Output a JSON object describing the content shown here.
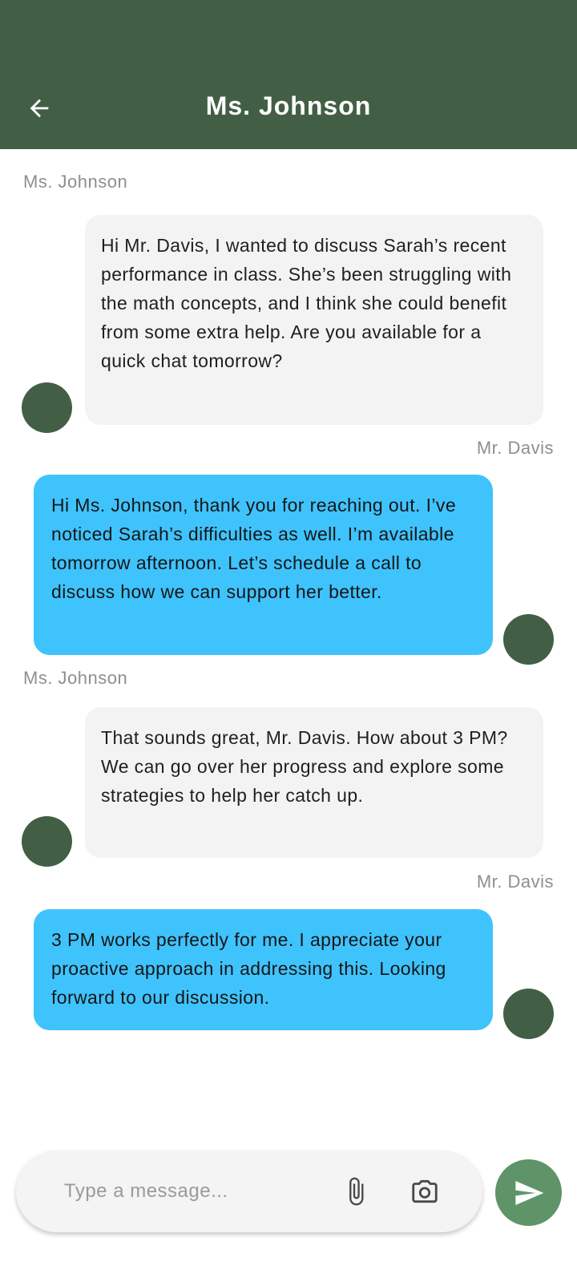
{
  "header": {
    "title": "Ms. Johnson",
    "back_icon": "arrow-back-icon",
    "color": "#425f45"
  },
  "messages": [
    {
      "sender": "Ms. Johnson",
      "side": "incoming",
      "text": "Hi Mr. Davis, I wanted to discuss Sarah’s recent performance in class. She’s been struggling with the math concepts, and I think she could benefit from some extra help. Are you available for a quick chat tomorrow?"
    },
    {
      "sender": "Mr. Davis",
      "side": "outgoing",
      "text": "Hi Ms. Johnson, thank you for reaching out. I’ve noticed Sarah’s difficulties as well. I’m available tomorrow afternoon. Let’s schedule a call to discuss how we can support her better."
    },
    {
      "sender": "Ms. Johnson",
      "side": "incoming",
      "text": "That sounds great, Mr. Davis. How about 3 PM? We can go over her progress and explore some strategies to help her catch up."
    },
    {
      "sender": "Mr. Davis",
      "side": "outgoing",
      "text": "3 PM works perfectly for me. I appreciate your proactive approach in addressing this. Looking forward to our discussion."
    }
  ],
  "composer": {
    "placeholder": "Type a message...",
    "value": "",
    "attach_icon": "paperclip-icon",
    "camera_icon": "camera-icon",
    "send_icon": "send-icon"
  },
  "colors": {
    "incoming_bubble": "#f3f3f3",
    "outgoing_bubble": "#3fc3fd",
    "avatar": "#425f45",
    "send_button": "#5f9469"
  }
}
